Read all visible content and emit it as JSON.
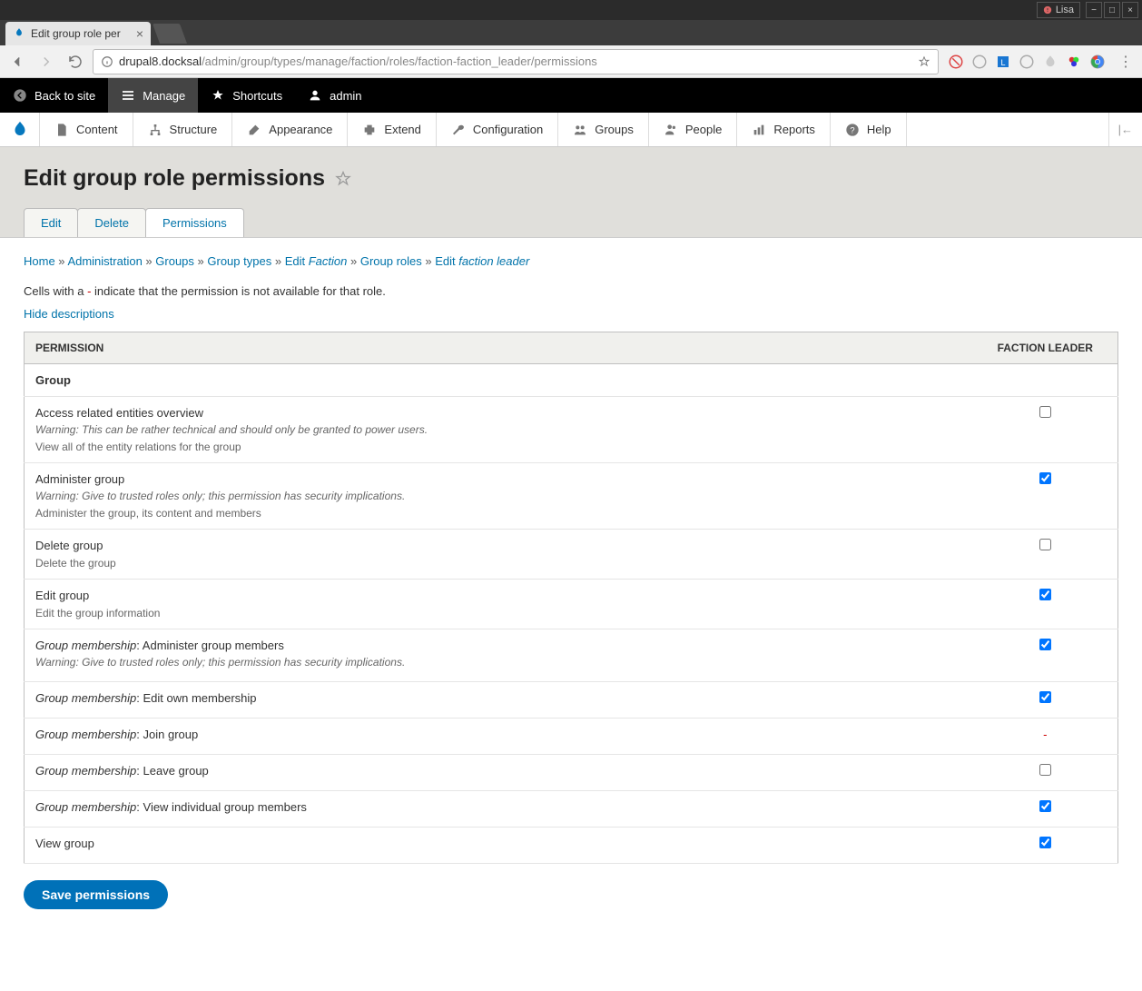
{
  "os": {
    "app_name": "Lisa"
  },
  "browser": {
    "tab_title": "Edit group role per",
    "url_host": "drupal8.docksal",
    "url_path": "/admin/group/types/manage/faction/roles/faction-faction_leader/permissions"
  },
  "drupal_toolbar": {
    "back": "Back to site",
    "manage": "Manage",
    "shortcuts": "Shortcuts",
    "user": "admin"
  },
  "admin_menu": {
    "content": "Content",
    "structure": "Structure",
    "appearance": "Appearance",
    "extend": "Extend",
    "configuration": "Configuration",
    "groups": "Groups",
    "people": "People",
    "reports": "Reports",
    "help": "Help"
  },
  "page_title": "Edit group role permissions",
  "tabs": {
    "edit": "Edit",
    "delete": "Delete",
    "permissions": "Permissions"
  },
  "breadcrumb": {
    "home": "Home",
    "admin": "Administration",
    "groups": "Groups",
    "group_types": "Group types",
    "edit_prefix": "Edit",
    "faction_em": "Faction",
    "group_roles": "Group roles",
    "leader_em": "faction leader"
  },
  "help_text": {
    "before": "Cells with a ",
    "dash": "-",
    "after": " indicate that the permission is not available for that role."
  },
  "toggle_desc": "Hide descriptions",
  "table": {
    "col_permission": "Permission",
    "col_role": "Faction leader",
    "section_group": "Group",
    "rows": [
      {
        "title": "Access related entities overview",
        "warn": "Warning: This can be rather technical and should only be granted to power users.",
        "desc": "View all of the entity relations for the group",
        "checked": false
      },
      {
        "title": "Administer group",
        "warn": "Warning: Give to trusted roles only; this permission has security implications.",
        "desc": "Administer the group, its content and members",
        "checked": true
      },
      {
        "title": "Delete group",
        "desc": "Delete the group",
        "checked": false
      },
      {
        "title": "Edit group",
        "desc": "Edit the group information",
        "checked": true
      },
      {
        "title_em": "Group membership",
        "title_rest": ": Administer group members",
        "warn": "Warning: Give to trusted roles only; this permission has security implications.",
        "checked": true
      },
      {
        "title_em": "Group membership",
        "title_rest": ": Edit own membership",
        "checked": true
      },
      {
        "title_em": "Group membership",
        "title_rest": ": Join group",
        "na": true
      },
      {
        "title_em": "Group membership",
        "title_rest": ": Leave group",
        "checked": false
      },
      {
        "title_em": "Group membership",
        "title_rest": ": View individual group members",
        "checked": true
      },
      {
        "title": "View group",
        "checked": true
      }
    ]
  },
  "save_button": "Save permissions"
}
